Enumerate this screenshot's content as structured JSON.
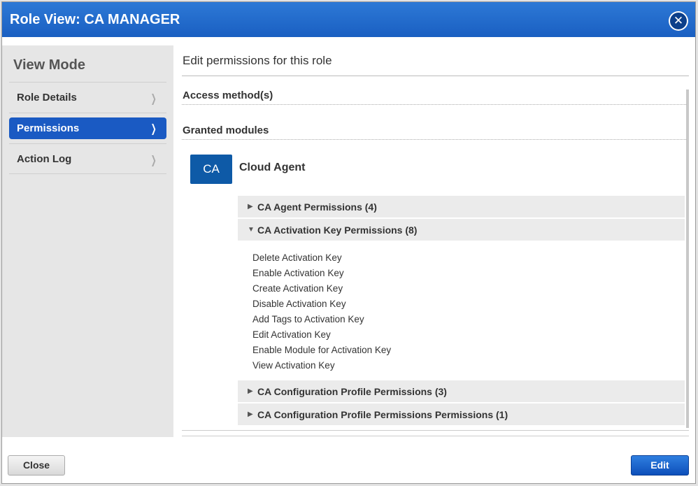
{
  "window": {
    "title": "Role View: CA MANAGER",
    "close_icon": "close-icon"
  },
  "sidebar": {
    "mode_title": "View Mode",
    "items": [
      {
        "label": "Role Details",
        "active": false
      },
      {
        "label": "Permissions",
        "active": true
      },
      {
        "label": "Action Log",
        "active": false
      }
    ]
  },
  "main": {
    "heading": "Edit permissions for this role",
    "access_methods_label": "Access method(s)",
    "granted_modules_label": "Granted modules",
    "module": {
      "badge": "CA",
      "name": "Cloud Agent",
      "groups": [
        {
          "label": "CA Agent Permissions (4)",
          "expanded": false
        },
        {
          "label": "CA Activation Key Permissions (8)",
          "expanded": true,
          "permissions": [
            "Delete Activation Key",
            "Enable Activation Key",
            "Create Activation Key",
            "Disable Activation Key",
            "Add Tags to Activation Key",
            "Edit Activation Key",
            "Enable Module for Activation Key",
            "View Activation Key"
          ]
        },
        {
          "label": "CA Configuration Profile Permissions (3)",
          "expanded": false
        },
        {
          "label": "CA Configuration Profile Permissions Permissions (1)",
          "expanded": false
        }
      ]
    }
  },
  "footer": {
    "close_label": "Close",
    "edit_label": "Edit"
  },
  "colors": {
    "titlebar": "#1a5fc2",
    "active_nav": "#1a5ac3",
    "badge": "#0e5aa7"
  }
}
